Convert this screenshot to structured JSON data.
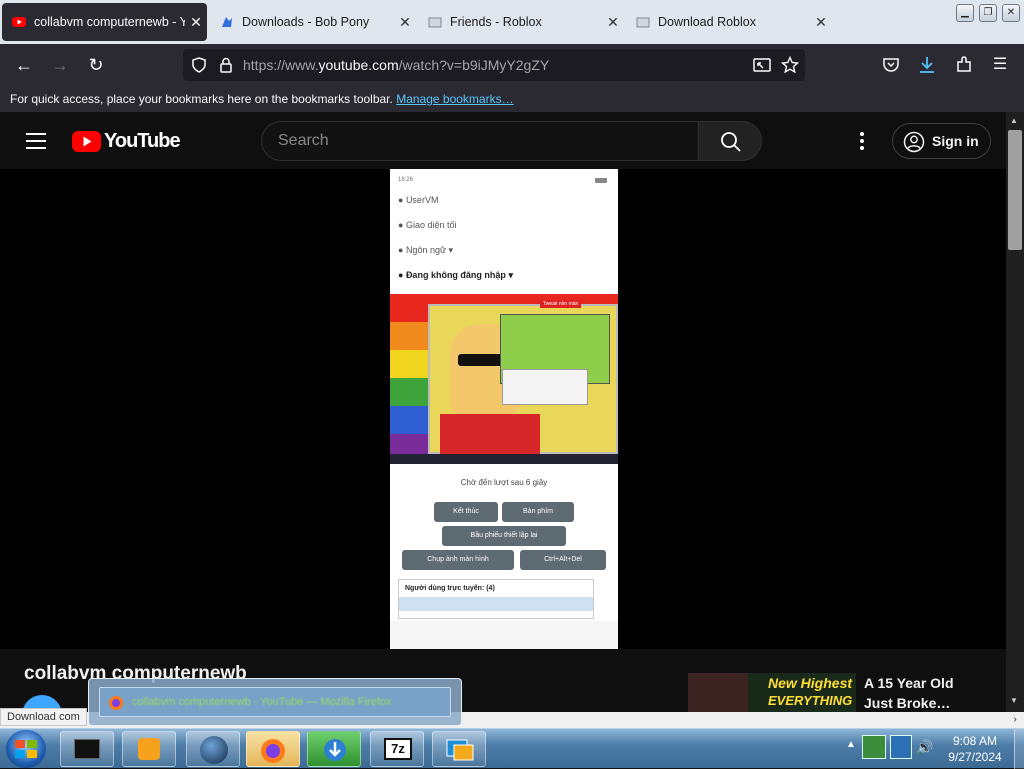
{
  "browser": {
    "tabs": [
      {
        "title": "collabvm computernewb - YouTube",
        "active": true
      },
      {
        "title": "Downloads - Bob Pony",
        "active": false
      },
      {
        "title": "Friends - Roblox",
        "active": false
      },
      {
        "title": "Download Roblox",
        "active": false
      }
    ],
    "url_prefix": "https://www.",
    "url_domain": "youtube.com",
    "url_rest": "/watch?v=b9iJMyY2gZY",
    "bookmarks_text": "For quick access, place your bookmarks here on the bookmarks toolbar.",
    "bookmarks_link": "Manage bookmarks…"
  },
  "youtube": {
    "logo_text": "YouTube",
    "search_placeholder": "Search",
    "signin_label": "Sign in",
    "channel_title": "collabvm computernewb",
    "recommended": {
      "title_line1": "A 15 Year Old",
      "title_line2": "Just Broke…",
      "thumb_text1": "New Highest",
      "thumb_text2": "EVERYTHING"
    }
  },
  "video": {
    "status_time": "18:26",
    "menu": [
      "UserVM",
      "Giao diện tối",
      "Ngôn ngữ",
      "Đang không đăng nhập"
    ],
    "vm_label": "Tweak nền màn",
    "wait_text": "Chờ đến lượt sau 6 giây",
    "buttons": [
      "Kết thúc",
      "Bàn phím",
      "Bầu phiếu thiết lập lại",
      "Chụp ảnh màn hình",
      "Ctrl+Alt+Del"
    ],
    "users_header": "Người dùng trực tuyến: (4)"
  },
  "status": {
    "download_partial": "Download com",
    "tooltip": "collabvm computernewb - YouTube — Mozilla Firefox"
  },
  "taskbar": {
    "time": "9:08 AM",
    "date": "9/27/2024",
    "seven_zip_label": "7z"
  },
  "colors": {
    "firefox_toolbar": "#2b2a33",
    "youtube_red": "#ff0000",
    "link_blue": "#59c8ff"
  }
}
